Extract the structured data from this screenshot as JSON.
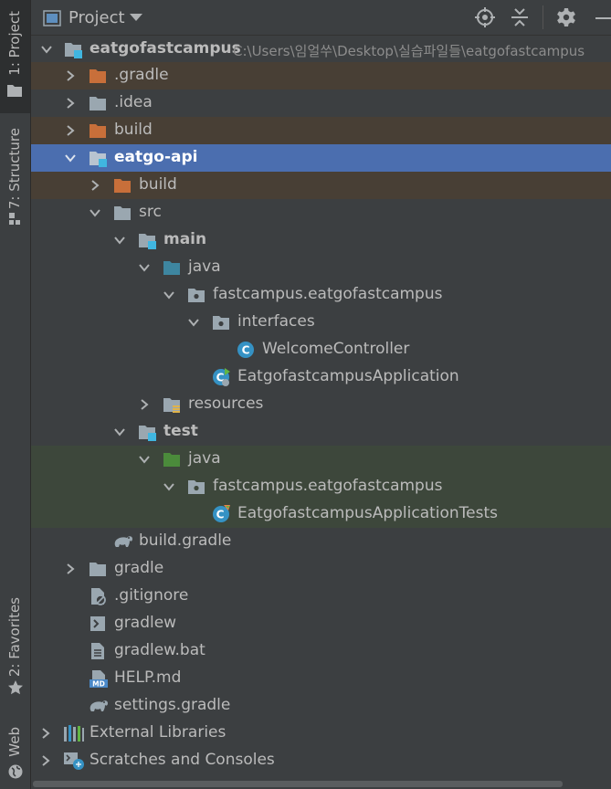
{
  "side_tabs": {
    "project": "1: Project",
    "structure": "7: Structure",
    "favorites": "2: Favorites",
    "web": "Web"
  },
  "header": {
    "title": "Project"
  },
  "tree": {
    "root_name": "eatgofastcampus",
    "root_path": "C:\\Users\\임얼쑤\\Desktop\\실습파일들\\eatgofastcampus",
    "gradle_dir": ".gradle",
    "idea_dir": ".idea",
    "build_dir": "build",
    "module": "eatgo-api",
    "module_build": "build",
    "src": "src",
    "main": "main",
    "main_java": "java",
    "main_package": "fastcampus.eatgofastcampus",
    "interfaces": "interfaces",
    "welcome_controller": "WelcomeController",
    "application": "EatgofastcampusApplication",
    "resources": "resources",
    "test": "test",
    "test_java": "java",
    "test_package": "fastcampus.eatgofastcampus",
    "application_tests": "EatgofastcampusApplicationTests",
    "module_build_gradle": "build.gradle",
    "gradle": "gradle",
    "gitignore": ".gitignore",
    "gradlew": "gradlew",
    "gradlew_bat": "gradlew.bat",
    "help": "HELP.md",
    "settings_gradle": "settings.gradle",
    "external_libraries": "External Libraries",
    "scratches": "Scratches and Consoles"
  },
  "colors": {
    "background": "#3c3f41",
    "selection": "#4b6eaf",
    "excluded_row": "#483f35",
    "test_row": "#3d473b",
    "excluded_folder": "#c86f3a",
    "source_folder": "#3e86a0",
    "test_folder": "#4b8b3b",
    "class_icon": "#3592c4"
  }
}
